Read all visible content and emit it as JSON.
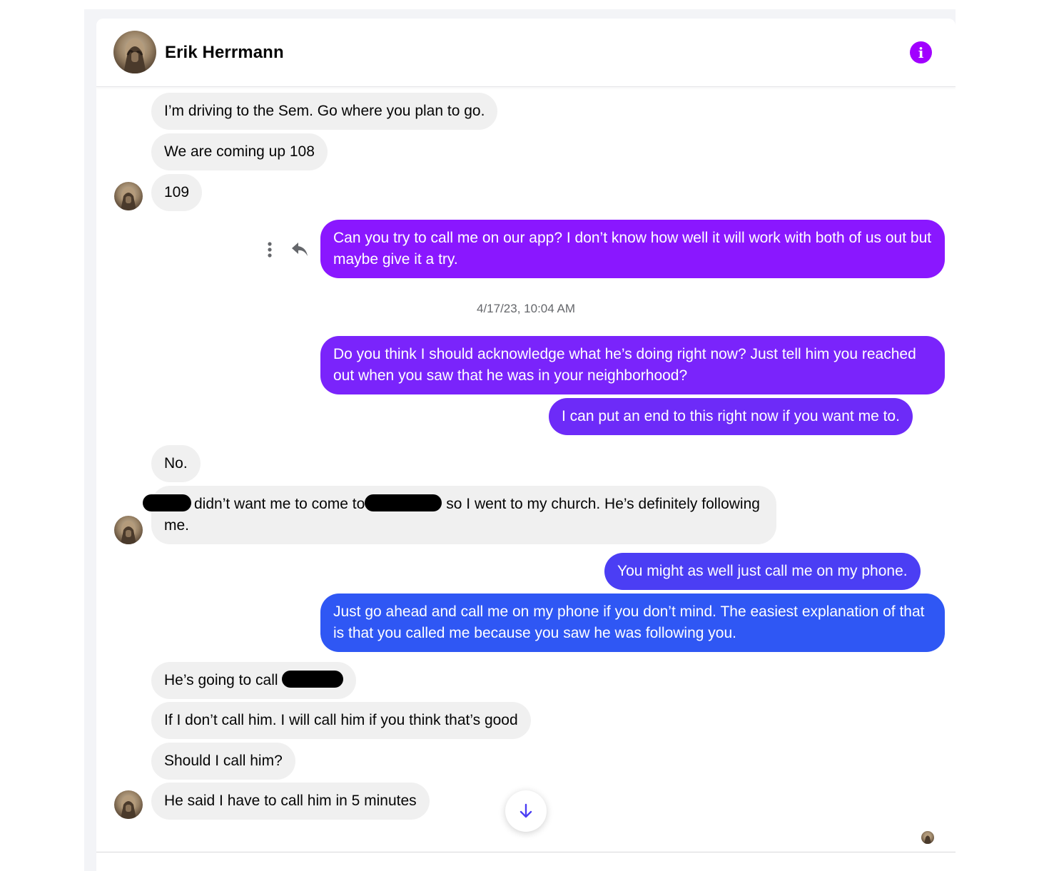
{
  "header": {
    "contact_name": "Erik Herrmann",
    "info_icon": "info-icon"
  },
  "messages": {
    "m1": "I’m driving to the Sem. Go where you plan to go.",
    "m2": "We are coming up 108",
    "m3": "109",
    "m4": "Can you try to call me on our app? I don’t know how well it will work with both of us out but maybe give it a try.",
    "timestamp": "4/17/23, 10:04 AM",
    "m5": "Do you think I should acknowledge what he’s doing right now? Just tell him you reached out when you saw that he was in your neighborhood?",
    "m6": "I can put an end to this right now if you want me to.",
    "m7": "No.",
    "m8_a": "didn’t want me to come to",
    "m8_b": "so I went to my church. He’s definitely following me.",
    "m9": "You might as well just call me on my phone.",
    "m10": "Just go ahead and call me on my phone if you don’t mind. The easiest explanation of that is that you called me because you saw he was following you.",
    "m11": "He’s going to call",
    "m12": "If I don’t call him. I will call him if you think that’s good",
    "m13": "Should I call him?",
    "m14": "He said I have to call him in 5 minutes"
  },
  "colors": {
    "outgoing_top": "#8a17ff",
    "outgoing_mid": "#6a2cf8",
    "outgoing_bottom": "#2f57f4",
    "incoming": "#f0f0f0",
    "accent": "#a100ff"
  },
  "icons": [
    "more-options-icon",
    "reply-icon",
    "scroll-down-arrow-icon",
    "info-icon"
  ]
}
